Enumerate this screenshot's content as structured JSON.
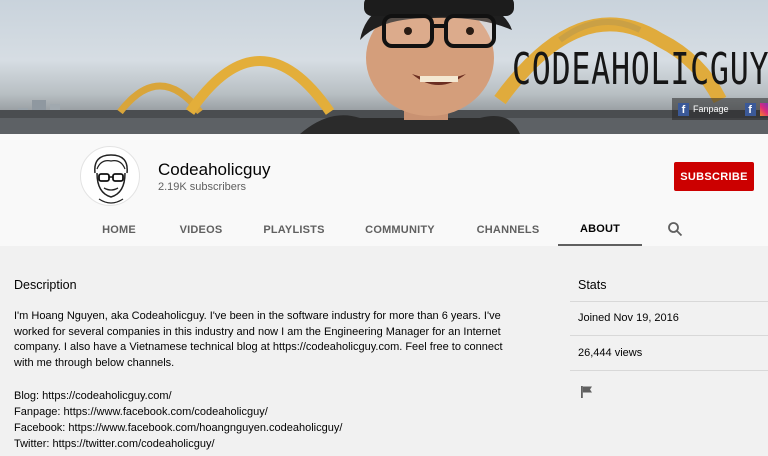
{
  "banner": {
    "title": "CODEAHOLICGUY",
    "social": {
      "label": "Fanpage"
    }
  },
  "channel": {
    "name": "Codeaholicguy",
    "subscribers": "2.19K subscribers",
    "subscribe_label": "SUBSCRIBE"
  },
  "tabs": [
    {
      "label": "HOME",
      "active": false
    },
    {
      "label": "VIDEOS",
      "active": false
    },
    {
      "label": "PLAYLISTS",
      "active": false
    },
    {
      "label": "COMMUNITY",
      "active": false
    },
    {
      "label": "CHANNELS",
      "active": false
    },
    {
      "label": "ABOUT",
      "active": true
    }
  ],
  "about": {
    "description_title": "Description",
    "description": "I'm Hoang Nguyen, aka Codeaholicguy. I've been in the software industry for more than 6 years. I've worked for several companies in this industry and now I am the Engineering Manager for an Internet company. I also have a Vietnamese technical blog at https://codeaholicguy.com. Feel free to connect with me through below channels.",
    "links": [
      "Blog: https://codeaholicguy.com/",
      "Fanpage: https://www.facebook.com/codeaholicguy/",
      "Facebook: https://www.facebook.com/hoangnguyen.codeaholicguy/",
      "Twitter: https://twitter.com/codeaholicguy/"
    ]
  },
  "stats": {
    "title": "Stats",
    "joined": "Joined Nov 19, 2016",
    "views": "26,444 views"
  },
  "icons": {
    "search": "search-icon",
    "flag": "flag-icon",
    "facebook": "facebook-icon",
    "instagram": "instagram-icon"
  },
  "colors": {
    "subscribe": "#cc0000",
    "facebook": "#3b5998",
    "background": "#f1f1f1"
  }
}
